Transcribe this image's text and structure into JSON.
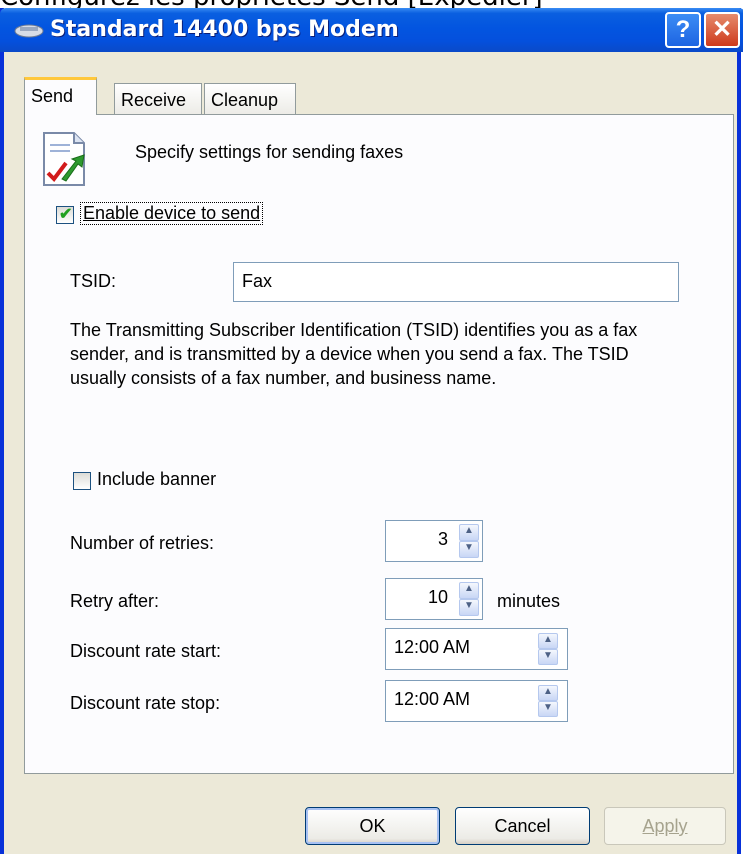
{
  "caption": "Configurez les propriétés Send [Expédier]",
  "window": {
    "title": "Standard 14400 bps Modem",
    "help_label": "?",
    "close_label": "✕"
  },
  "tabs": [
    {
      "label": "Send",
      "active": true
    },
    {
      "label": "Receive",
      "active": false
    },
    {
      "label": "Cleanup",
      "active": false
    }
  ],
  "send": {
    "description": "Specify settings for sending faxes",
    "enable_label": "Enable device to send",
    "enable_checked": true,
    "tsid_label": "TSID:",
    "tsid_value": "Fax",
    "tsid_help_1": "The Transmitting Subscriber Identification (TSID) identifies you as a fax",
    "tsid_help_2": "sender, and is transmitted by a device when you send a fax. The TSID",
    "tsid_help_3": "usually consists of a fax number, and business name.",
    "banner_label": "Include banner",
    "banner_checked": false,
    "retries_label": "Number of retries:",
    "retries_value": "3",
    "retry_after_label": "Retry after:",
    "retry_after_value": "10",
    "minutes_label": "minutes",
    "discount_start_label": "Discount rate start:",
    "discount_start_value": "12:00 AM",
    "discount_stop_label": "Discount rate stop:",
    "discount_stop_value": "12:00 AM"
  },
  "buttons": {
    "ok": "OK",
    "cancel": "Cancel",
    "apply": "Apply"
  },
  "icons": {
    "title": "fax-modem-icon",
    "send": "send-fax-icon",
    "spin_up": "▲",
    "spin_down": "▼"
  }
}
